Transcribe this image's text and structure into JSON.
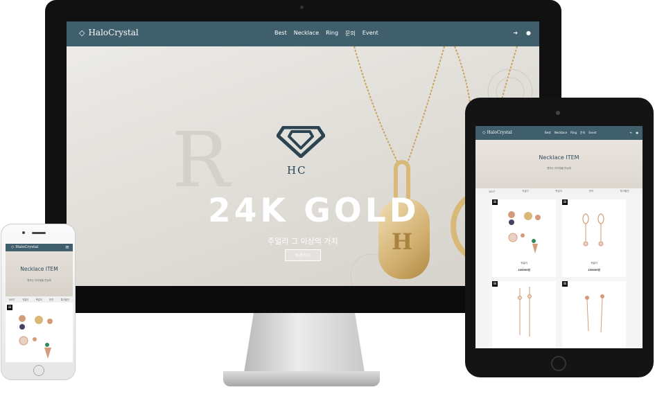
{
  "brand": {
    "name": "HaloCrystal"
  },
  "nav": {
    "links": [
      "Best",
      "Necklace",
      "Ring",
      "문의",
      "Event"
    ],
    "icons": [
      "login-icon",
      "user-icon"
    ]
  },
  "hero": {
    "background_letter": "R",
    "logo_text": "HC",
    "title": "24K GOLD",
    "subtitle": "주얼리 그 이상의 가치",
    "button_label": "바로가기",
    "pendant_letter": "H"
  },
  "product_page": {
    "title": "Necklace ITEM",
    "subtitle": "원하는 아이템을 만능해",
    "tablet_categories": [
      "BEST",
      "귀걸이",
      "목걸이",
      "반지",
      "특가할인"
    ],
    "phone_categories": [
      "BEST",
      "귀걸이",
      "목걸이",
      "반지",
      "특가할인"
    ],
    "products": [
      {
        "name": "귀걸이",
        "price": "100000원"
      },
      {
        "name": "귀걸이",
        "price": "150000원"
      },
      {
        "name": "",
        "price": ""
      },
      {
        "name": "",
        "price": ""
      }
    ]
  },
  "colors": {
    "nav_bg": "#3f5f6c",
    "hero_bg": "#e6e2dc",
    "gold": "#c9a55c",
    "rose_gold": "#d59a7a",
    "title_color": "#2e4a57"
  }
}
